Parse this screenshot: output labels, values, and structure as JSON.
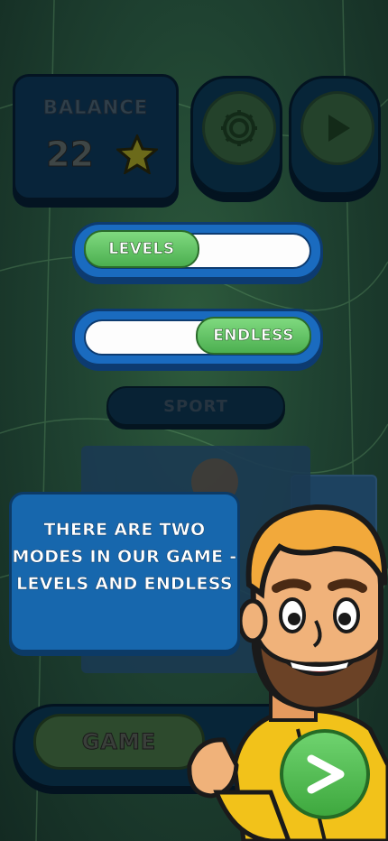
{
  "balance": {
    "label": "BALANCE",
    "value": "22"
  },
  "icons": {
    "settings": "gear-icon",
    "play": "play-icon",
    "star": "star-icon",
    "next": "chevron-right-icon"
  },
  "modes": {
    "levels_label": "LEVELS",
    "endless_label": "ENDLESS",
    "sport_label": "SPORT"
  },
  "tooltip": {
    "text": "THERE ARE TWO MODES IN OUR GAME - LEVELS AND ENDLESS"
  },
  "game": {
    "label": "GAME"
  },
  "next": {
    "label": ">"
  },
  "colors": {
    "accent_blue": "#1767ad",
    "accent_green": "#4caf50",
    "background": "#1e3a2c"
  }
}
